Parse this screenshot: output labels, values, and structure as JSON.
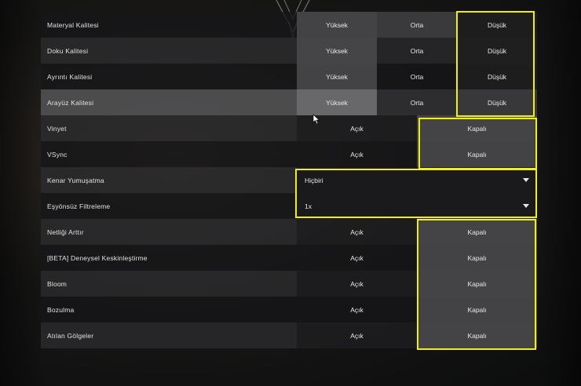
{
  "settings": {
    "quality_rows": [
      {
        "label": "Materyal Kalitesi",
        "options": [
          "Yüksek",
          "Orta",
          "Düşük"
        ]
      },
      {
        "label": "Doku Kalitesi",
        "options": [
          "Yüksek",
          "Orta",
          "Düşük"
        ]
      },
      {
        "label": "Ayrıntı Kalitesi",
        "options": [
          "Yüksek",
          "Orta",
          "Düşük"
        ]
      },
      {
        "label": "Arayüz Kalitesi",
        "options": [
          "Yüksek",
          "Orta",
          "Düşük"
        ]
      }
    ],
    "toggle_rows_a": [
      {
        "label": "Vinyet",
        "on": "Açık",
        "off": "Kapalı"
      },
      {
        "label": "VSync",
        "on": "Açık",
        "off": "Kapalı"
      }
    ],
    "dropdown_rows": [
      {
        "label": "Kenar Yumuşatma",
        "value": "Hiçbiri"
      },
      {
        "label": "Eşyönsüz Filtreleme",
        "value": "1x"
      }
    ],
    "toggle_rows_b": [
      {
        "label": "Netliği Arttır",
        "on": "Açık",
        "off": "Kapalı"
      },
      {
        "label": "[BETA] Deneysel Keskinleştirme",
        "on": "Açık",
        "off": "Kapalı"
      },
      {
        "label": "Bloom",
        "on": "Açık",
        "off": "Kapalı"
      },
      {
        "label": "Bozulma",
        "on": "Açık",
        "off": "Kapalı"
      },
      {
        "label": "Atılan Gölgeler",
        "on": "Açık",
        "off": "Kapalı"
      }
    ]
  },
  "colors": {
    "highlight_box": "#f2f200"
  },
  "icons": {
    "background_logo": "valorant-logo-icon",
    "cursor": "mouse-cursor-icon"
  }
}
